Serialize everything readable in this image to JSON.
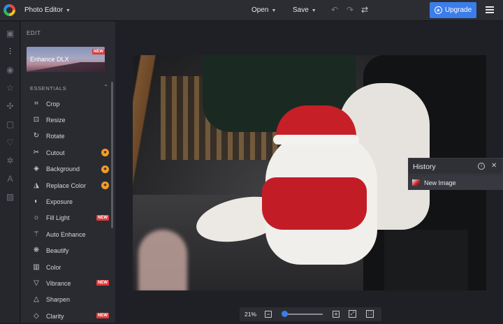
{
  "header": {
    "app_menu": "Photo Editor",
    "open": "Open",
    "save": "Save",
    "upgrade": "Upgrade",
    "colors": {
      "accent": "#3b7de9",
      "badge_new": "#e23a3a",
      "badge_star": "#f39c27"
    }
  },
  "rail": {
    "icons": [
      "image-icon",
      "sliders-icon",
      "eye-icon",
      "star-icon",
      "shapes-icon",
      "frame-icon",
      "heart-icon",
      "gear-icon",
      "text-icon",
      "texture-icon"
    ],
    "active": "sliders-icon"
  },
  "panel": {
    "title": "EDIT",
    "banner": {
      "label": "Enhance DLX",
      "badge": "NEW"
    },
    "section": "ESSENTIALS",
    "tools": [
      {
        "label": "Crop",
        "icon": "crop-icon",
        "badge": ""
      },
      {
        "label": "Resize",
        "icon": "resize-icon",
        "badge": ""
      },
      {
        "label": "Rotate",
        "icon": "rotate-icon",
        "badge": ""
      },
      {
        "label": "Cutout",
        "icon": "scissors-icon",
        "badge": "star"
      },
      {
        "label": "Background",
        "icon": "eraser-icon",
        "badge": "star"
      },
      {
        "label": "Replace Color",
        "icon": "drop-icon",
        "badge": "star"
      },
      {
        "label": "Exposure",
        "icon": "exposure-icon",
        "badge": ""
      },
      {
        "label": "Fill Light",
        "icon": "sun-icon",
        "badge": "NEW"
      },
      {
        "label": "Auto Enhance",
        "icon": "magic-icon",
        "badge": ""
      },
      {
        "label": "Beautify",
        "icon": "sparkle-icon",
        "badge": ""
      },
      {
        "label": "Color",
        "icon": "palette-icon",
        "badge": ""
      },
      {
        "label": "Vibrance",
        "icon": "triangle-down-icon",
        "badge": "NEW"
      },
      {
        "label": "Sharpen",
        "icon": "triangle-up-icon",
        "badge": ""
      },
      {
        "label": "Clarity",
        "icon": "diamond-icon",
        "badge": "NEW"
      }
    ]
  },
  "history": {
    "title": "History",
    "items": [
      "New Image"
    ]
  },
  "zoom": {
    "value": "21%",
    "level": 0.21
  }
}
